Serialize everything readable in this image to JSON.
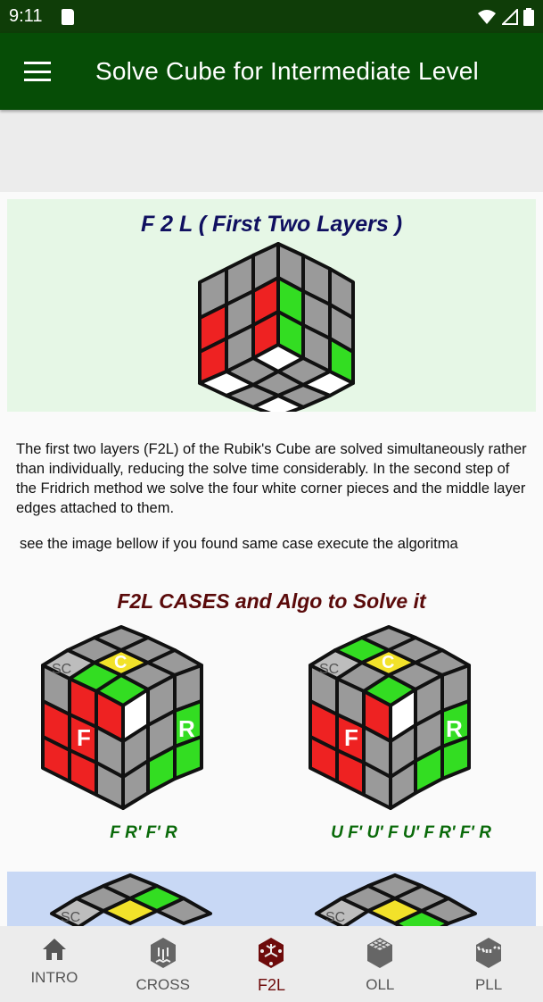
{
  "status_bar": {
    "time": "9:11",
    "icons": [
      "sd-card-icon",
      "wifi-icon",
      "signal-icon",
      "battery-icon"
    ]
  },
  "app_bar": {
    "menu_icon": "hamburger-menu-icon",
    "title": "Solve Cube for Intermediate Level"
  },
  "intro": {
    "title": "F 2 L ( First Two Layers )",
    "paragraph": "The first two layers (F2L) of the Rubik's Cube are solved simultaneously rather than individually, reducing the solve time considerably. In the second step of the Fridrich method we solve the four white corner pieces and the middle layer edges attached to them.",
    "hint": "see the image bellow if you found same case execute the algoritma"
  },
  "cases": {
    "title": "F2L CASES and Algo to Solve it",
    "items": [
      {
        "algorithm": "F R' F' R",
        "labels": {
          "sc": "SC",
          "f": "F",
          "r": "R"
        }
      },
      {
        "algorithm": "U F' U' F U' F R' F' R",
        "labels": {
          "sc": "SC",
          "f": "F",
          "r": "R"
        }
      },
      {
        "labels": {
          "sc": "SC"
        }
      },
      {
        "labels": {
          "sc": "SC"
        }
      }
    ]
  },
  "colors": {
    "status_bar": "#0f3d08",
    "app_bar": "#064d06",
    "active_tab": "#6e0b0b",
    "inactive_tab": "#555555",
    "cube_red": "#ee2222",
    "cube_green": "#33dd22",
    "cube_gray": "#9a9a9a",
    "cube_yellow": "#f2e22a"
  },
  "bottom_nav": {
    "items": [
      {
        "label": "INTRO",
        "icon": "home-icon",
        "active": false
      },
      {
        "label": "CROSS",
        "icon": "cross-cube-icon",
        "active": false
      },
      {
        "label": "F2L",
        "icon": "f2l-cube-icon",
        "active": true
      },
      {
        "label": "OLL",
        "icon": "oll-cube-icon",
        "active": false
      },
      {
        "label": "PLL",
        "icon": "pll-cube-icon",
        "active": false
      }
    ]
  }
}
